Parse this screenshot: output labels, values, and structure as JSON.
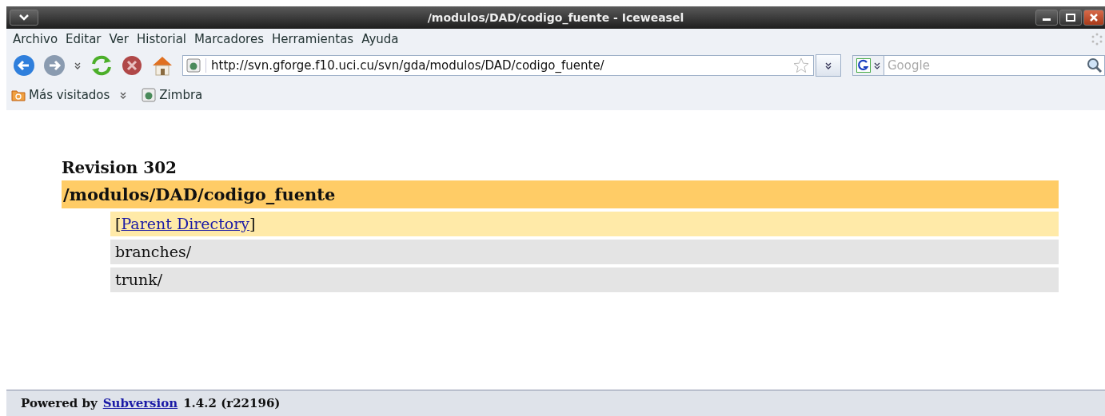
{
  "window": {
    "title": "/modulos/DAD/codigo_fuente - Iceweasel"
  },
  "menu": [
    "Archivo",
    "Editar",
    "Ver",
    "Historial",
    "Marcadores",
    "Herramientas",
    "Ayuda"
  ],
  "toolbar": {
    "url": "http://svn.gforge.f10.uci.cu/svn/gda/modulos/DAD/codigo_fuente/",
    "search_placeholder": "Google"
  },
  "bookmarks": [
    {
      "label": "Más visitados",
      "kind": "folder"
    },
    {
      "label": "Zimbra",
      "kind": "page"
    }
  ],
  "page": {
    "revision": "Revision 302",
    "path": "/modulos/DAD/codigo_fuente",
    "entries": [
      {
        "kind": "parent",
        "open": "[",
        "link": "Parent Directory",
        "close": "]"
      },
      {
        "kind": "dir",
        "name": "branches/"
      },
      {
        "kind": "dir",
        "name": "trunk/"
      }
    ]
  },
  "footer": {
    "prefix": "Powered by",
    "link": "Subversion",
    "suffix": "1.4.2 (r22196)"
  }
}
